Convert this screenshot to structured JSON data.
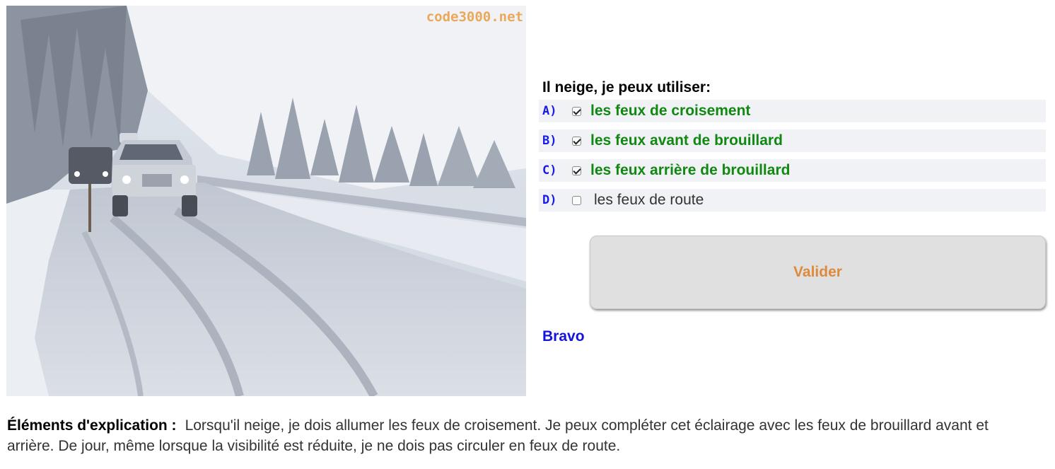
{
  "image": {
    "watermark": "code3000.net"
  },
  "question": {
    "title": "Il neige, je peux utiliser:",
    "answers": [
      {
        "letter": "A)",
        "text": "les feux de croisement",
        "checked": true
      },
      {
        "letter": "B)",
        "text": "les feux avant de brouillard",
        "checked": true
      },
      {
        "letter": "C)",
        "text": "les feux arrière de brouillard",
        "checked": true
      },
      {
        "letter": "D)",
        "text": "les feux de route",
        "checked": false
      }
    ]
  },
  "actions": {
    "validate_label": "Valider"
  },
  "result": {
    "text": "Bravo"
  },
  "explanation": {
    "label": "Éléments d'explication :",
    "text": "Lorsqu'il neige, je dois allumer les feux de croisement. Je peux compléter cet éclairage avec les feux de brouillard avant et arrière. De jour, même lorsque la visibilité est réduite, je ne dois pas circuler en feux de route."
  },
  "colors": {
    "correct_answer": "#118811",
    "letter": "#1a1ae6",
    "button_text": "#dd8a3e",
    "result": "#1414dc"
  }
}
